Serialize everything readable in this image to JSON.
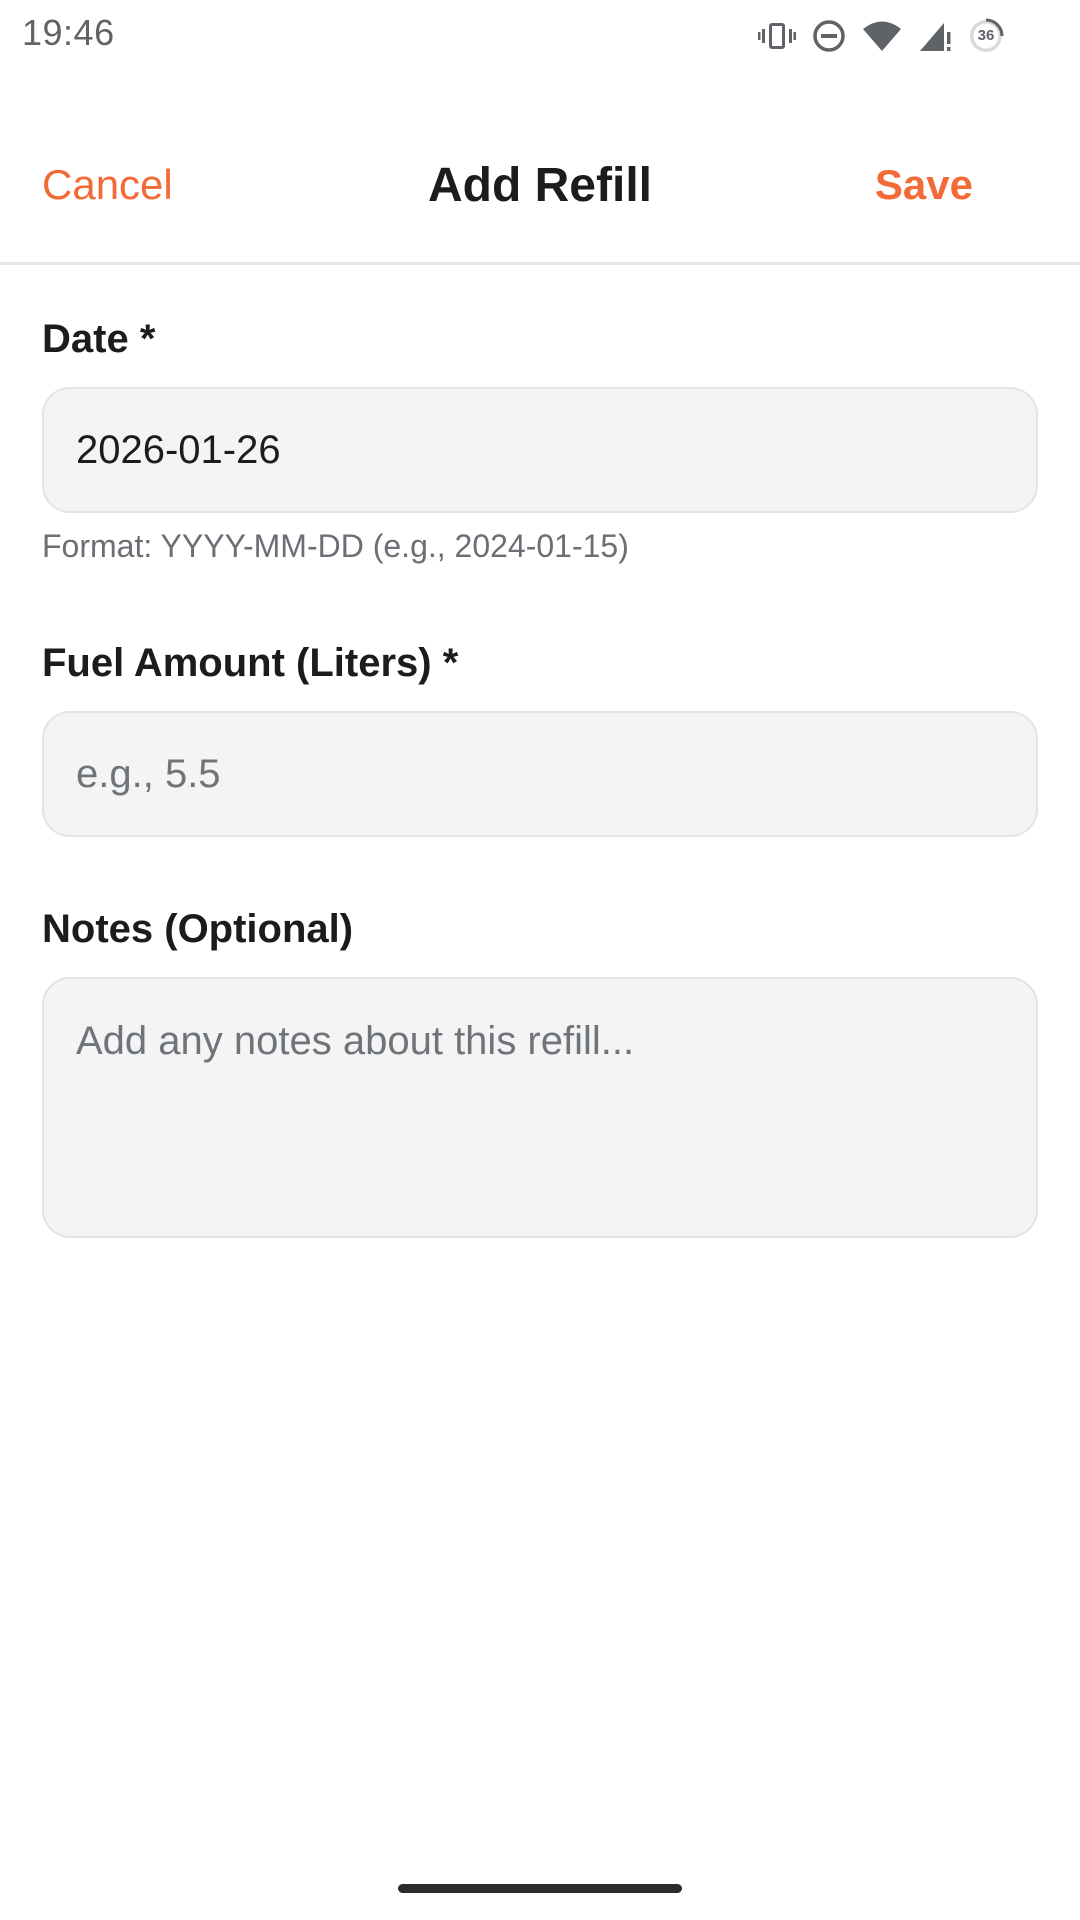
{
  "status_bar": {
    "time": "19:46",
    "icons": [
      "vibrate-icon",
      "do-not-disturb-icon",
      "wifi-icon",
      "cell-signal-icon",
      "battery-icon"
    ],
    "battery_level": "36"
  },
  "header": {
    "cancel_label": "Cancel",
    "title": "Add Refill",
    "save_label": "Save"
  },
  "form": {
    "date": {
      "label": "Date *",
      "value": "2026-01-26",
      "helper": "Format: YYYY-MM-DD (e.g., 2024-01-15)"
    },
    "fuel_amount": {
      "label": "Fuel Amount (Liters) *",
      "value": "",
      "placeholder": "e.g., 5.5"
    },
    "notes": {
      "label": "Notes (Optional)",
      "value": "",
      "placeholder": "Add any notes about this refill..."
    }
  },
  "colors": {
    "accent": "#f26a35",
    "field_background": "#f4f4f4",
    "field_border": "#e3e3e3",
    "title_text": "#1c1c1e",
    "muted_text": "#6b6f75"
  }
}
